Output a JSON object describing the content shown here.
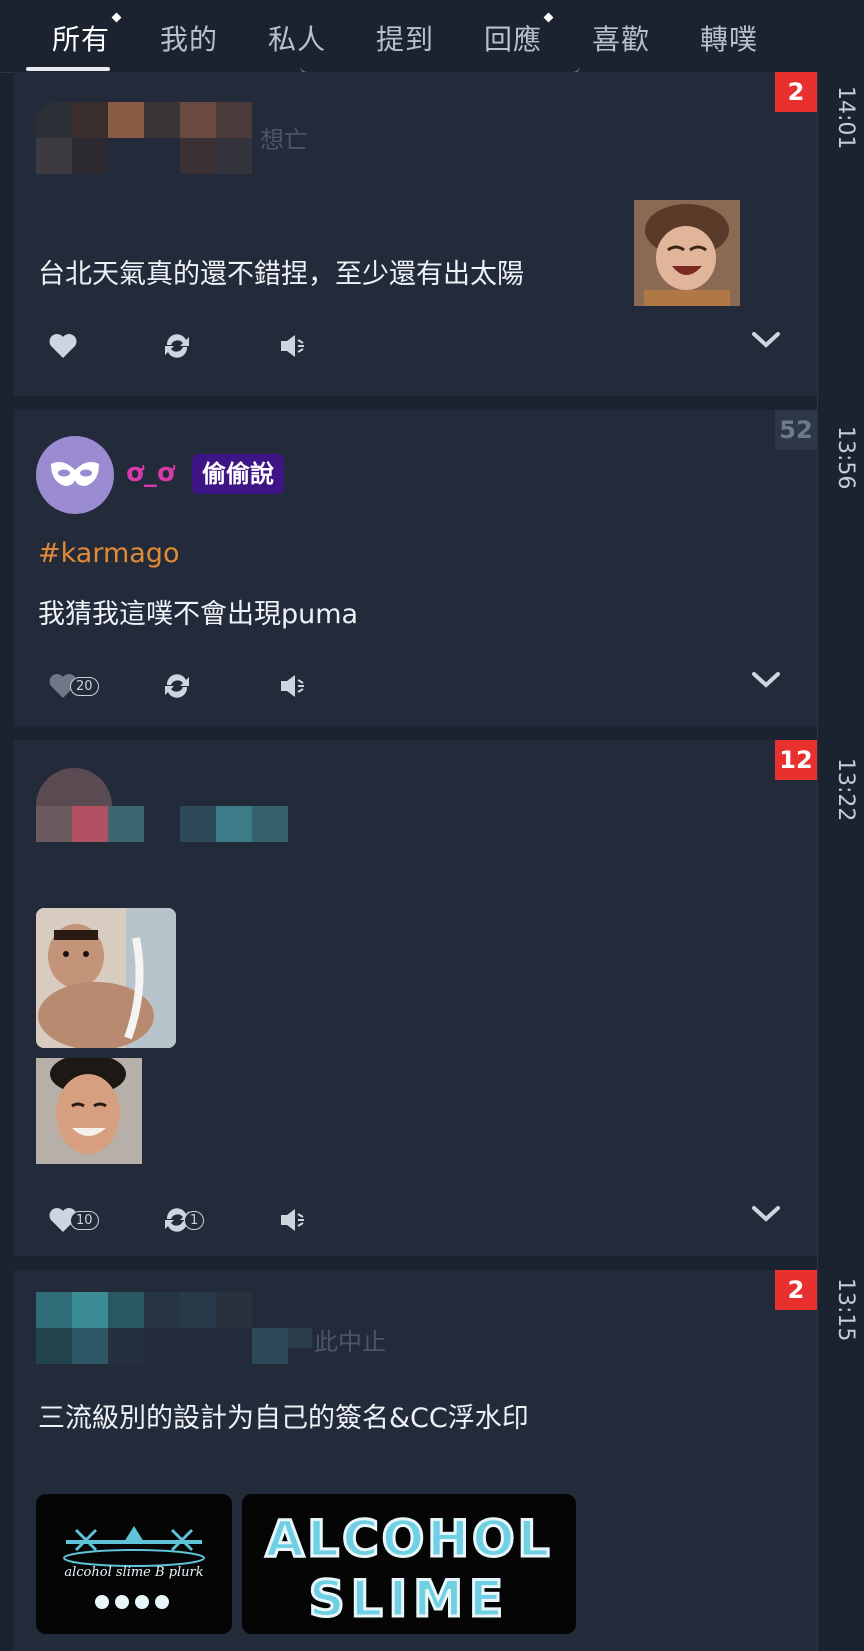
{
  "tabs": [
    {
      "label": "所有",
      "active": true,
      "unread": true
    },
    {
      "label": "我的",
      "active": false,
      "unread": false
    },
    {
      "label": "私人",
      "active": false,
      "unread": false
    },
    {
      "label": "提到",
      "active": false,
      "unread": false
    },
    {
      "label": "回應",
      "active": false,
      "unread": true
    },
    {
      "label": "喜歡",
      "active": false,
      "unread": false
    },
    {
      "label": "轉噗",
      "active": false,
      "unread": false
    }
  ],
  "timeline": [
    "14:01",
    "13:56",
    "13:22",
    "13:15"
  ],
  "posts": [
    {
      "badge": "2",
      "author_partial": "想亡",
      "text": "台北天氣真的還不錯捏，至少還有出太陽",
      "emoticon": "laughing-face-emoticon"
    },
    {
      "badge": "52",
      "author": "ơ_ơ",
      "tag": "偷偷說",
      "hashtag": "#karmago",
      "text": "我猜我這噗不會出現puma",
      "likes": "20"
    },
    {
      "badge": "12",
      "likes": "10",
      "replurks": "1"
    },
    {
      "badge": "2",
      "author_partial": "此中止",
      "text": "三流級別的設計为自己的簽名&CC浮水印",
      "logo_small_text": "alcohol slime B plurk",
      "logo_big_line1": "ALCOHOL",
      "logo_big_line2": "SLIME"
    }
  ],
  "colors": {
    "background": "#1b2230",
    "card": "#232b3a",
    "badge_unread": "#e8312f",
    "badge_read": "#2d3747",
    "hashtag": "#e08a35",
    "anon_tag": "#3e1585",
    "nick": "#d63aa8"
  }
}
